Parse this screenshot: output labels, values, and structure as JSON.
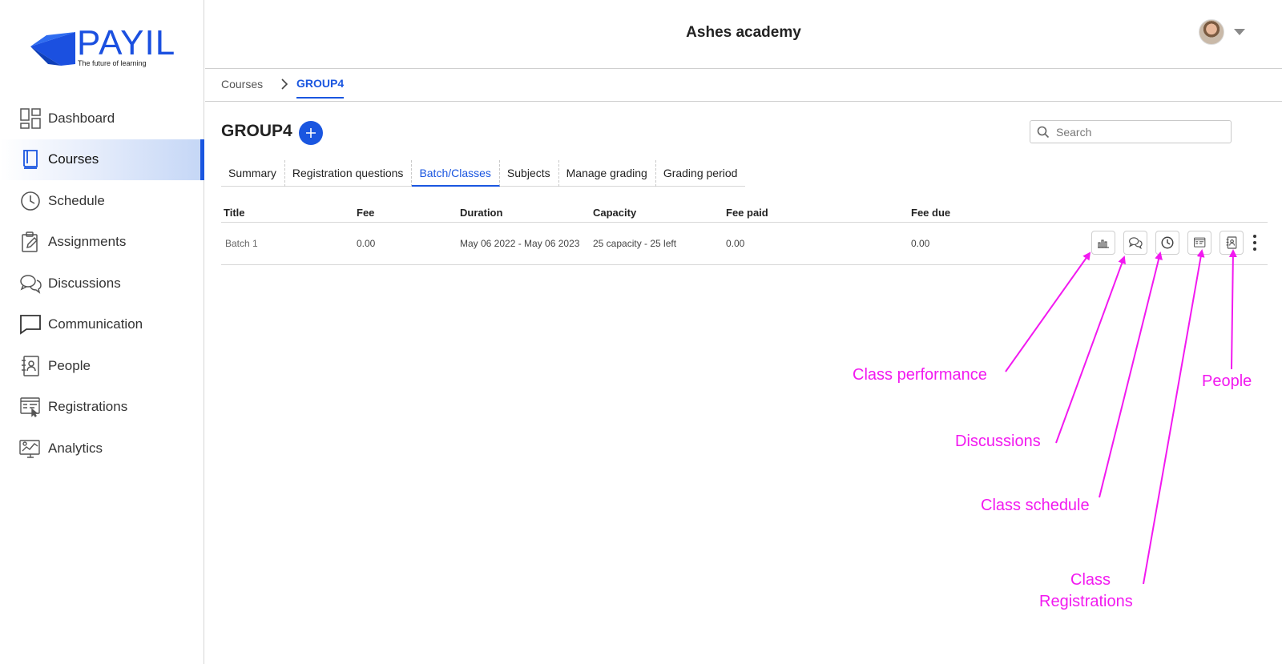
{
  "brand": {
    "name": "PAYIL",
    "tagline": "The future of learning",
    "color": "#1b50e0"
  },
  "header": {
    "org_name": "Ashes academy",
    "avatar_icon": "user-avatar",
    "menu_icon": "caret-down-icon"
  },
  "sidebar": {
    "items": [
      {
        "label": "Dashboard",
        "icon": "dashboard-icon",
        "active": false
      },
      {
        "label": "Courses",
        "icon": "book-icon",
        "active": true
      },
      {
        "label": "Schedule",
        "icon": "clock-icon",
        "active": false
      },
      {
        "label": "Assignments",
        "icon": "clipboard-pencil-icon",
        "active": false
      },
      {
        "label": "Discussions",
        "icon": "chat-bubbles-icon",
        "active": false
      },
      {
        "label": "Communication",
        "icon": "message-icon",
        "active": false
      },
      {
        "label": "People",
        "icon": "contact-book-icon",
        "active": false
      },
      {
        "label": "Registrations",
        "icon": "registration-form-icon",
        "active": false
      },
      {
        "label": "Analytics",
        "icon": "analytics-icon",
        "active": false
      }
    ]
  },
  "breadcrumb": {
    "root": "Courses",
    "current": "GROUP4"
  },
  "page": {
    "title": "GROUP4",
    "add_icon": "plus-icon",
    "search_placeholder": "Search",
    "search_value": ""
  },
  "tabs": [
    {
      "label": "Summary",
      "active": false
    },
    {
      "label": "Registration questions",
      "active": false
    },
    {
      "label": "Batch/Classes",
      "active": true
    },
    {
      "label": "Subjects",
      "active": false
    },
    {
      "label": "Manage grading",
      "active": false
    },
    {
      "label": "Grading period",
      "active": false
    }
  ],
  "table": {
    "columns": [
      "Title",
      "Fee",
      "Duration",
      "Capacity",
      "Fee paid",
      "Fee due"
    ],
    "rows": [
      {
        "cells": [
          "Batch 1",
          "0.00",
          "May 06 2022 - May 06 2023",
          "25 capacity - 25 left",
          "0.00",
          "0.00"
        ]
      }
    ],
    "row_actions": [
      {
        "icon": "bar-chart-icon"
      },
      {
        "icon": "chat-bubbles-icon"
      },
      {
        "icon": "clock-icon"
      },
      {
        "icon": "registrations-icon"
      },
      {
        "icon": "contact-book-icon"
      },
      {
        "icon": "more-vertical-icon"
      }
    ]
  },
  "annotations": {
    "color": "#f219f0",
    "class_performance": "Class performance",
    "discussions": "Discussions",
    "class_schedule": "Class schedule",
    "class_registrations_line1": "Class",
    "class_registrations_line2": "Registrations",
    "people": "People"
  },
  "colors": {
    "accent": "#1a56e0",
    "border": "#d8d8d8"
  }
}
